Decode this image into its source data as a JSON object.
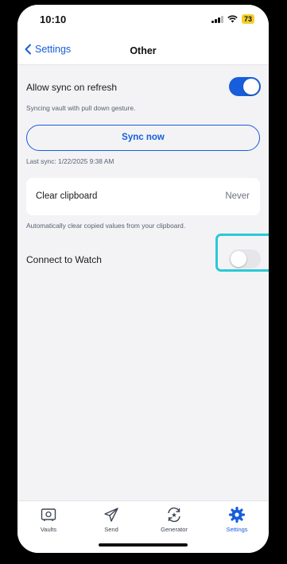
{
  "status_bar": {
    "time": "10:10",
    "battery": "73"
  },
  "nav": {
    "back_label": "Settings",
    "title": "Other"
  },
  "sync": {
    "allow_label": "Allow sync on refresh",
    "allow_enabled": true,
    "allow_helper": "Syncing vault with pull down gesture.",
    "button_label": "Sync now",
    "last_sync": "Last sync: 1/22/2025 9:38 AM"
  },
  "clipboard": {
    "label": "Clear clipboard",
    "value": "Never",
    "helper": "Automatically clear copied values from your clipboard."
  },
  "watch": {
    "label": "Connect to Watch",
    "enabled": false
  },
  "tabs": [
    {
      "label": "Vaults",
      "icon": "vault-icon",
      "active": false
    },
    {
      "label": "Send",
      "icon": "send-icon",
      "active": false
    },
    {
      "label": "Generator",
      "icon": "generator-icon",
      "active": false
    },
    {
      "label": "Settings",
      "icon": "settings-gear-icon",
      "active": true
    }
  ],
  "colors": {
    "accent": "#175ddc",
    "highlight": "#2ac9d6",
    "background": "#f3f3f6"
  }
}
